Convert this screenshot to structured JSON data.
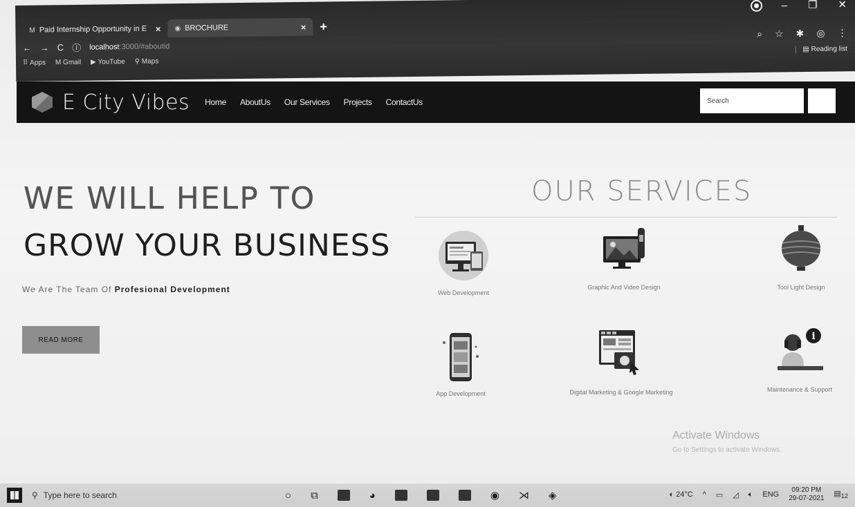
{
  "browser": {
    "tabs": [
      {
        "label": "Paid Internship Opportunity in E",
        "icon": "gmail-icon"
      },
      {
        "label": "BROCHURE",
        "icon": "globe-icon"
      }
    ],
    "url_host": "localhost",
    "url_rest": ":3000/#aboutid",
    "bookmarks": [
      "Apps",
      "Gmail",
      "YouTube",
      "Maps"
    ],
    "reading_list": "Reading list"
  },
  "site": {
    "brand": "E City Vibes",
    "nav": [
      "Home",
      "AboutUs",
      "Our Services",
      "Projects",
      "ContactUs"
    ],
    "search_placeholder": "Search"
  },
  "hero": {
    "line1": "WE WILL HELP TO",
    "line2": "GROW YOUR BUSINESS",
    "tagline_pre": "We Are The Team Of ",
    "tagline_bold": "Profesional Development",
    "button": "READ MORE"
  },
  "services": {
    "title": "OUR SERVICES",
    "items": [
      {
        "label": "Web Development",
        "icon": "desktop-tablet-icon"
      },
      {
        "label": "Graphic And Video Design",
        "icon": "monitor-pen-icon"
      },
      {
        "label": "Tool Light Design",
        "icon": "lantern-icon"
      },
      {
        "label": "App Development",
        "icon": "phone-app-icon"
      },
      {
        "label": "Digital Marketing & Google Marketing",
        "icon": "web-browser-icon"
      },
      {
        "label": "Maintenance & Support",
        "icon": "support-agent-icon"
      }
    ]
  },
  "watermark": {
    "title": "Activate Windows",
    "subtitle": "Go to Settings to activate Windows."
  },
  "taskbar": {
    "search_placeholder": "Type here to search",
    "temperature": "24°C",
    "language": "ENG",
    "time": "09:20 PM",
    "date": "29-07-2021",
    "notifications": "12"
  }
}
